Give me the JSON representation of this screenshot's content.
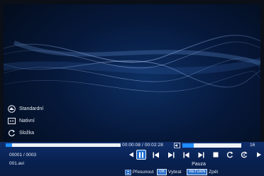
{
  "menu": {
    "items": [
      {
        "label": "Standardní",
        "icon": "aspect-standard-icon"
      },
      {
        "label": "Nativní",
        "icon": "aspect-native-icon"
      },
      {
        "label": "Složka",
        "icon": "folder-repeat-icon"
      }
    ]
  },
  "playback": {
    "time": "00:00:08 / 00:02:28",
    "progress_fraction": 0.055,
    "volume_value": "16",
    "volume_fraction": 0.2,
    "counter": "00001 / 0003",
    "filename": "001.avi",
    "status": "Pauza"
  },
  "controls": [
    {
      "name": "prev-arrow-icon"
    },
    {
      "name": "pause-icon",
      "selected": true
    },
    {
      "name": "rewind-icon"
    },
    {
      "name": "fast-forward-icon"
    },
    {
      "name": "skip-previous-icon"
    },
    {
      "name": "skip-next-icon"
    },
    {
      "name": "stop-icon"
    },
    {
      "name": "repeat-icon"
    },
    {
      "name": "repeat-one-icon"
    },
    {
      "name": "next-arrow-icon"
    }
  ],
  "hints": {
    "move": "Přesunout",
    "ok_key": "OK",
    "select": "Vybrat",
    "return_key": "RETURN",
    "back": "Zpět"
  },
  "colors": {
    "accent": "#1f8cff",
    "bar_bg": "#0f2e6a",
    "selected_bg": "#1f6fd0"
  }
}
